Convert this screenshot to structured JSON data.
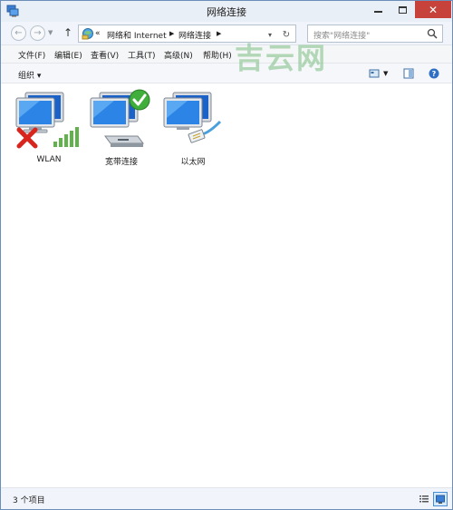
{
  "window": {
    "title": "网络连接",
    "controls": {
      "minimize": "minimize-icon",
      "maximize": "maximize-icon",
      "close": "close-icon"
    }
  },
  "nav": {
    "overflow": "«",
    "breadcrumb": [
      "网络和 Internet",
      "网络连接"
    ],
    "search_placeholder": "搜索\"网络连接\""
  },
  "menu": {
    "items": [
      "文件(F)",
      "编辑(E)",
      "查看(V)",
      "工具(T)",
      "高级(N)",
      "帮助(H)"
    ]
  },
  "commandbar": {
    "organize_label": "组织 ▾"
  },
  "adapters": [
    {
      "label": "WLAN",
      "status": "disconnected",
      "status_icon": "red-x-icon",
      "extra_icon": "signal-bars-icon"
    },
    {
      "label": "宽带连接",
      "status": "connected",
      "status_icon": "green-check-icon",
      "extra_icon": "modem-icon"
    },
    {
      "label": "以太网",
      "status": "connected",
      "status_icon": "",
      "extra_icon": "ethernet-cable-icon"
    }
  ],
  "watermark": "吉云网",
  "status": {
    "item_count": "3 个项目"
  },
  "colors": {
    "title_bg": "#e9eff6",
    "close_button": "#c7423a",
    "window_border": "#6b8fb8",
    "watermark": "#78be82",
    "selected_view": "#d8e9fb"
  }
}
